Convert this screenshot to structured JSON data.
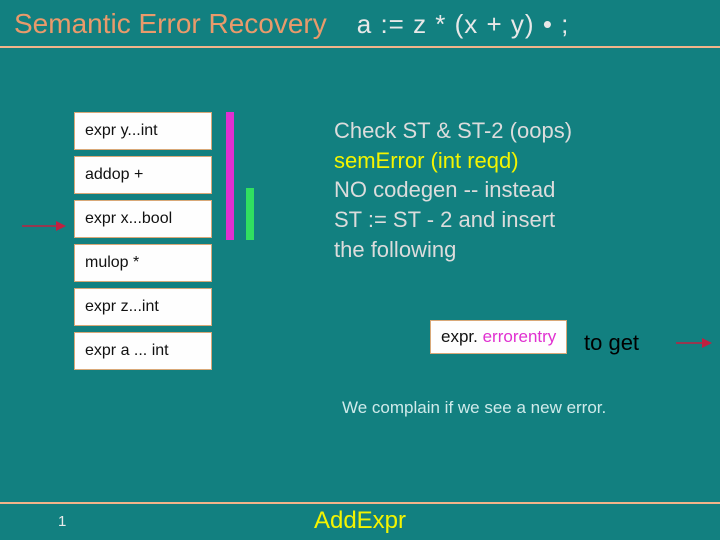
{
  "header": {
    "title": "Semantic Error Recovery",
    "expression": "a := z * (x + y) • ;"
  },
  "stack": [
    "expr y...int",
    "addop +",
    "expr x...bool",
    "mulop   *",
    "expr z...int",
    "expr a ... int"
  ],
  "rhs": {
    "line1": "Check ST & ST-2 (oops)",
    "line2": "semError (int reqd)",
    "line3": "NO codegen -- instead",
    "line4": " ST := ST - 2 and insert",
    "line5": "the following"
  },
  "errorbox": {
    "prefix": "expr. ",
    "entry": "errorentry"
  },
  "toget": "to get",
  "complain": "We complain if we see a new error.",
  "footer": {
    "page": "1",
    "label": "AddExpr"
  }
}
